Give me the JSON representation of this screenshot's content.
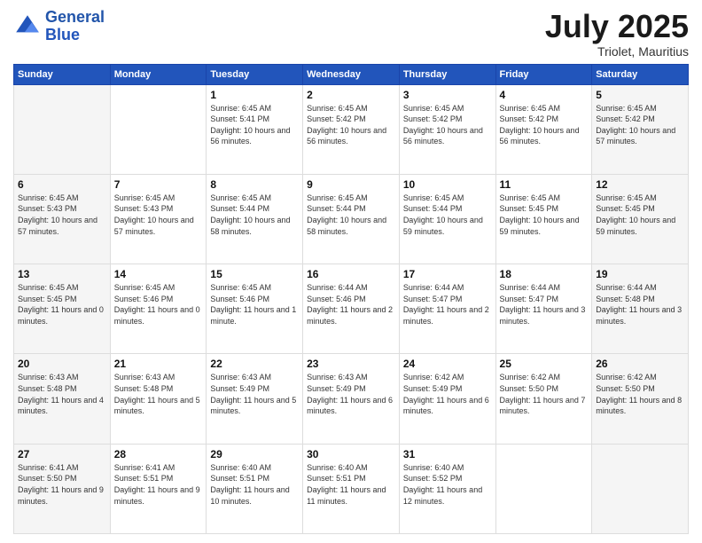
{
  "header": {
    "logo_line1": "General",
    "logo_line2": "Blue",
    "month": "July 2025",
    "location": "Triolet, Mauritius"
  },
  "days_of_week": [
    "Sunday",
    "Monday",
    "Tuesday",
    "Wednesday",
    "Thursday",
    "Friday",
    "Saturday"
  ],
  "weeks": [
    [
      {
        "day": "",
        "sunrise": "",
        "sunset": "",
        "daylight": ""
      },
      {
        "day": "",
        "sunrise": "",
        "sunset": "",
        "daylight": ""
      },
      {
        "day": "1",
        "sunrise": "Sunrise: 6:45 AM",
        "sunset": "Sunset: 5:41 PM",
        "daylight": "Daylight: 10 hours and 56 minutes."
      },
      {
        "day": "2",
        "sunrise": "Sunrise: 6:45 AM",
        "sunset": "Sunset: 5:42 PM",
        "daylight": "Daylight: 10 hours and 56 minutes."
      },
      {
        "day": "3",
        "sunrise": "Sunrise: 6:45 AM",
        "sunset": "Sunset: 5:42 PM",
        "daylight": "Daylight: 10 hours and 56 minutes."
      },
      {
        "day": "4",
        "sunrise": "Sunrise: 6:45 AM",
        "sunset": "Sunset: 5:42 PM",
        "daylight": "Daylight: 10 hours and 56 minutes."
      },
      {
        "day": "5",
        "sunrise": "Sunrise: 6:45 AM",
        "sunset": "Sunset: 5:42 PM",
        "daylight": "Daylight: 10 hours and 57 minutes."
      }
    ],
    [
      {
        "day": "6",
        "sunrise": "Sunrise: 6:45 AM",
        "sunset": "Sunset: 5:43 PM",
        "daylight": "Daylight: 10 hours and 57 minutes."
      },
      {
        "day": "7",
        "sunrise": "Sunrise: 6:45 AM",
        "sunset": "Sunset: 5:43 PM",
        "daylight": "Daylight: 10 hours and 57 minutes."
      },
      {
        "day": "8",
        "sunrise": "Sunrise: 6:45 AM",
        "sunset": "Sunset: 5:44 PM",
        "daylight": "Daylight: 10 hours and 58 minutes."
      },
      {
        "day": "9",
        "sunrise": "Sunrise: 6:45 AM",
        "sunset": "Sunset: 5:44 PM",
        "daylight": "Daylight: 10 hours and 58 minutes."
      },
      {
        "day": "10",
        "sunrise": "Sunrise: 6:45 AM",
        "sunset": "Sunset: 5:44 PM",
        "daylight": "Daylight: 10 hours and 59 minutes."
      },
      {
        "day": "11",
        "sunrise": "Sunrise: 6:45 AM",
        "sunset": "Sunset: 5:45 PM",
        "daylight": "Daylight: 10 hours and 59 minutes."
      },
      {
        "day": "12",
        "sunrise": "Sunrise: 6:45 AM",
        "sunset": "Sunset: 5:45 PM",
        "daylight": "Daylight: 10 hours and 59 minutes."
      }
    ],
    [
      {
        "day": "13",
        "sunrise": "Sunrise: 6:45 AM",
        "sunset": "Sunset: 5:45 PM",
        "daylight": "Daylight: 11 hours and 0 minutes."
      },
      {
        "day": "14",
        "sunrise": "Sunrise: 6:45 AM",
        "sunset": "Sunset: 5:46 PM",
        "daylight": "Daylight: 11 hours and 0 minutes."
      },
      {
        "day": "15",
        "sunrise": "Sunrise: 6:45 AM",
        "sunset": "Sunset: 5:46 PM",
        "daylight": "Daylight: 11 hours and 1 minute."
      },
      {
        "day": "16",
        "sunrise": "Sunrise: 6:44 AM",
        "sunset": "Sunset: 5:46 PM",
        "daylight": "Daylight: 11 hours and 2 minutes."
      },
      {
        "day": "17",
        "sunrise": "Sunrise: 6:44 AM",
        "sunset": "Sunset: 5:47 PM",
        "daylight": "Daylight: 11 hours and 2 minutes."
      },
      {
        "day": "18",
        "sunrise": "Sunrise: 6:44 AM",
        "sunset": "Sunset: 5:47 PM",
        "daylight": "Daylight: 11 hours and 3 minutes."
      },
      {
        "day": "19",
        "sunrise": "Sunrise: 6:44 AM",
        "sunset": "Sunset: 5:48 PM",
        "daylight": "Daylight: 11 hours and 3 minutes."
      }
    ],
    [
      {
        "day": "20",
        "sunrise": "Sunrise: 6:43 AM",
        "sunset": "Sunset: 5:48 PM",
        "daylight": "Daylight: 11 hours and 4 minutes."
      },
      {
        "day": "21",
        "sunrise": "Sunrise: 6:43 AM",
        "sunset": "Sunset: 5:48 PM",
        "daylight": "Daylight: 11 hours and 5 minutes."
      },
      {
        "day": "22",
        "sunrise": "Sunrise: 6:43 AM",
        "sunset": "Sunset: 5:49 PM",
        "daylight": "Daylight: 11 hours and 5 minutes."
      },
      {
        "day": "23",
        "sunrise": "Sunrise: 6:43 AM",
        "sunset": "Sunset: 5:49 PM",
        "daylight": "Daylight: 11 hours and 6 minutes."
      },
      {
        "day": "24",
        "sunrise": "Sunrise: 6:42 AM",
        "sunset": "Sunset: 5:49 PM",
        "daylight": "Daylight: 11 hours and 6 minutes."
      },
      {
        "day": "25",
        "sunrise": "Sunrise: 6:42 AM",
        "sunset": "Sunset: 5:50 PM",
        "daylight": "Daylight: 11 hours and 7 minutes."
      },
      {
        "day": "26",
        "sunrise": "Sunrise: 6:42 AM",
        "sunset": "Sunset: 5:50 PM",
        "daylight": "Daylight: 11 hours and 8 minutes."
      }
    ],
    [
      {
        "day": "27",
        "sunrise": "Sunrise: 6:41 AM",
        "sunset": "Sunset: 5:50 PM",
        "daylight": "Daylight: 11 hours and 9 minutes."
      },
      {
        "day": "28",
        "sunrise": "Sunrise: 6:41 AM",
        "sunset": "Sunset: 5:51 PM",
        "daylight": "Daylight: 11 hours and 9 minutes."
      },
      {
        "day": "29",
        "sunrise": "Sunrise: 6:40 AM",
        "sunset": "Sunset: 5:51 PM",
        "daylight": "Daylight: 11 hours and 10 minutes."
      },
      {
        "day": "30",
        "sunrise": "Sunrise: 6:40 AM",
        "sunset": "Sunset: 5:51 PM",
        "daylight": "Daylight: 11 hours and 11 minutes."
      },
      {
        "day": "31",
        "sunrise": "Sunrise: 6:40 AM",
        "sunset": "Sunset: 5:52 PM",
        "daylight": "Daylight: 11 hours and 12 minutes."
      },
      {
        "day": "",
        "sunrise": "",
        "sunset": "",
        "daylight": ""
      },
      {
        "day": "",
        "sunrise": "",
        "sunset": "",
        "daylight": ""
      }
    ]
  ]
}
